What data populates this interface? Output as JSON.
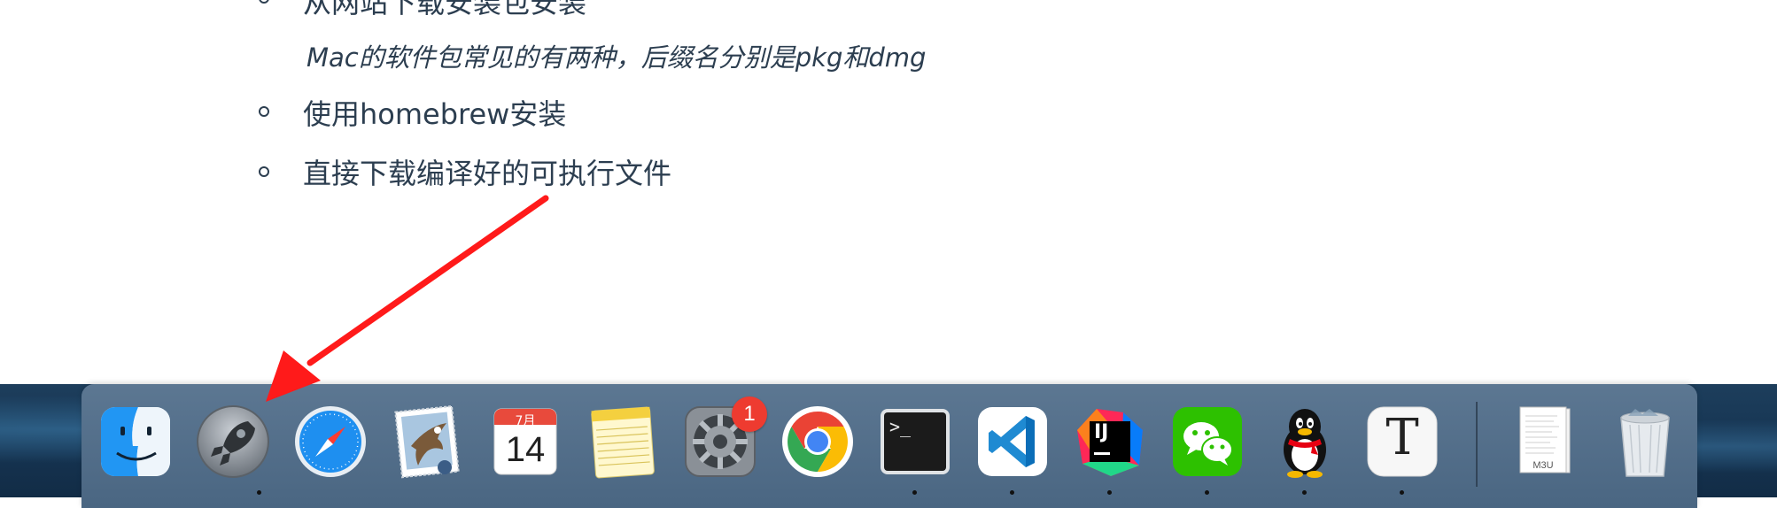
{
  "document": {
    "partial_top_line": "从网站下载安装包安装",
    "note_italic": "Mac的软件包常见的有两种，后缀名分别是pkg和dmg",
    "bullet_homebrew": "使用homebrew安装",
    "bullet_binary": "直接下载编译好的可执行文件",
    "text_color": "#2c3e50"
  },
  "annotation": {
    "arrow_color": "#ff1a1a",
    "points_to": "launchpad-icon"
  },
  "dock": {
    "apps": [
      {
        "name": "Finder",
        "icon": "finder-icon"
      },
      {
        "name": "Launchpad",
        "icon": "rocket-icon"
      },
      {
        "name": "Safari",
        "icon": "compass-icon"
      },
      {
        "name": "Mail",
        "icon": "eagle-stamp-icon"
      },
      {
        "name": "Calendar",
        "icon": "calendar-icon",
        "month": "7月",
        "day": "14"
      },
      {
        "name": "Notes",
        "icon": "notepad-icon"
      },
      {
        "name": "System Preferences",
        "icon": "gear-icon",
        "badge": "1"
      },
      {
        "name": "Google Chrome",
        "icon": "chrome-icon"
      },
      {
        "name": "Terminal",
        "icon": "terminal-icon",
        "prompt": ">_"
      },
      {
        "name": "Visual Studio Code",
        "icon": "vscode-icon"
      },
      {
        "name": "IntelliJ IDEA",
        "icon": "intellij-icon",
        "label": "IJ"
      },
      {
        "name": "WeChat",
        "icon": "wechat-icon"
      },
      {
        "name": "QQ",
        "icon": "penguin-icon"
      },
      {
        "name": "Typora",
        "icon": "typora-icon",
        "letter": "T"
      }
    ],
    "file_stack_label": "M3U",
    "trash": {
      "name": "Trash",
      "icon": "trash-icon"
    },
    "background": "#54708c"
  }
}
